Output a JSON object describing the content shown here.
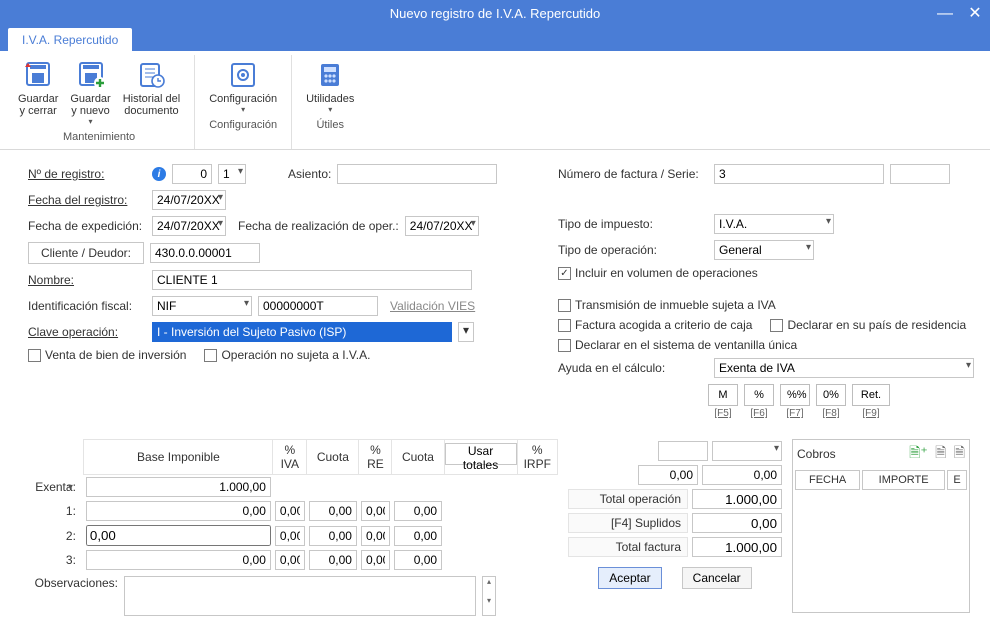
{
  "window": {
    "title": "Nuevo registro de I.V.A. Repercutido",
    "tab": "I.V.A. Repercutido"
  },
  "ribbon": {
    "groups": {
      "mantenimiento": "Mantenimiento",
      "configuracion": "Configuración",
      "utiles": "Útiles"
    },
    "buttons": {
      "guardar_cerrar": "Guardar\ny cerrar",
      "guardar_nuevo": "Guardar\ny nuevo",
      "historial": "Historial del\ndocumento",
      "configuracion": "Configuración",
      "utilidades": "Utilidades"
    }
  },
  "left": {
    "nreg_label": "Nº de registro:",
    "nreg_value": "0",
    "nreg_serie": "1",
    "asiento_label": "Asiento:",
    "asiento_value": "",
    "fecha_reg_label": "Fecha del registro:",
    "fecha_reg": "24/07/20XX",
    "fecha_exp_label": "Fecha de expedición:",
    "fecha_exp": "24/07/20XX",
    "fecha_oper_label": "Fecha de realización de oper.:",
    "fecha_oper": "24/07/20XX",
    "cliente_btn": "Cliente / Deudor:",
    "cliente_val": "430.0.0.00001",
    "nombre_label": "Nombre:",
    "nombre_val": "CLIENTE 1",
    "ident_label": "Identificación fiscal:",
    "ident_tipo": "NIF",
    "ident_val": "00000000T",
    "vies": "Validación VIES",
    "clave_label": "Clave operación:",
    "clave_val": "I - Inversión del Sujeto Pasivo (ISP)",
    "chk_venta": "Venta de bien de inversión",
    "chk_no_sujeta": "Operación no sujeta a I.V.A."
  },
  "right": {
    "numfac_label": "Número de factura / Serie:",
    "numfac_val": "3",
    "serie_val": "",
    "tipo_imp_label": "Tipo de impuesto:",
    "tipo_imp_val": "I.V.A.",
    "tipo_oper_label": "Tipo de operación:",
    "tipo_oper_val": "General",
    "chk_volumen": "Incluir en volumen de operaciones",
    "chk_transm": "Transmisión de inmueble sujeta a IVA",
    "chk_caja": "Factura acogida a criterio de caja",
    "chk_pais": "Declarar en su país de residencia",
    "chk_ventanilla": "Declarar en el sistema de ventanilla única",
    "ayuda_label": "Ayuda en el cálculo:",
    "ayuda_val": "Exenta de IVA",
    "mini": {
      "m": "M",
      "pct": "%",
      "pctpct": "%%",
      "zeropct": "0%",
      "ret": "Ret."
    },
    "fkeys": {
      "f5": "[F5]",
      "f6": "[F6]",
      "f7": "[F7]",
      "f8": "[F8]",
      "f9": "[F9]"
    }
  },
  "grid": {
    "h_base": "Base Imponible",
    "h_piva": "% IVA",
    "h_cuota": "Cuota",
    "h_pre": "% RE",
    "h_cuota2": "Cuota",
    "h_usar": "Usar totales",
    "h_irpf": "% IRPF",
    "rowlabels": {
      "exenta": "Exenta:",
      "r1": "1:",
      "r2": "2:",
      "r3": "3:"
    },
    "exenta_base": "1.000,00",
    "zero": "0,00",
    "obs_label": "Observaciones:"
  },
  "totals": {
    "irpf_val": "0,00",
    "ret_val": "0,00",
    "total_oper_l": "Total operación",
    "total_oper_v": "1.000,00",
    "suplidos_l": "[F4] Suplidos",
    "suplidos_v": "0,00",
    "total_fac_l": "Total factura",
    "total_fac_v": "1.000,00"
  },
  "cobros": {
    "title": "Cobros",
    "col_fecha": "FECHA",
    "col_importe": "IMPORTE",
    "col_e": "E"
  },
  "dlg": {
    "aceptar": "Aceptar",
    "cancelar": "Cancelar"
  }
}
